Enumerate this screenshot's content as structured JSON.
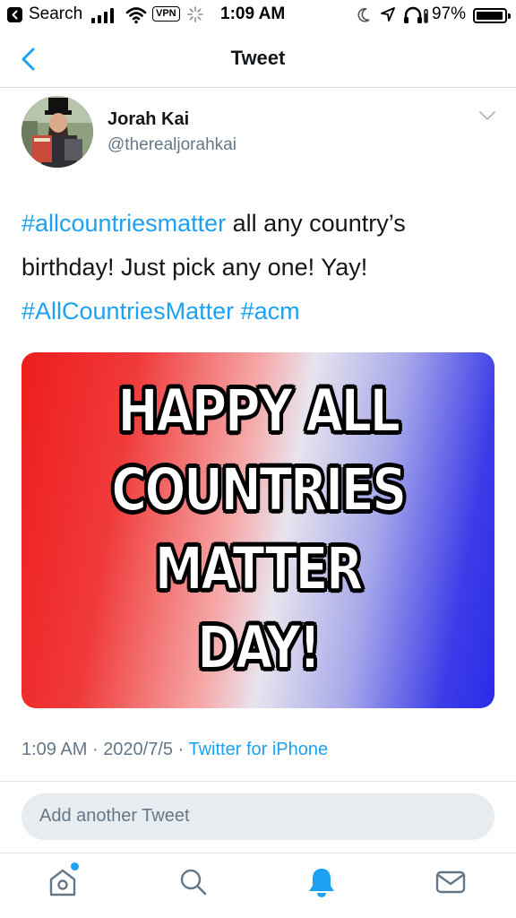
{
  "status_bar": {
    "back_app": "Search",
    "vpn": "VPN",
    "time": "1:09 AM",
    "battery_percent": "97%",
    "battery_level": 0.97
  },
  "header": {
    "title": "Tweet"
  },
  "tweet": {
    "author_name": "Jorah Kai",
    "author_handle": "@therealjorahkai",
    "text_segments": [
      {
        "text": "#allcountriesmatter",
        "hashtag": true
      },
      {
        "text": " all any country’s birthday! Just pick any one! Yay! ",
        "hashtag": false
      },
      {
        "text": "#AllCountriesMatter",
        "hashtag": true
      },
      {
        "text": " ",
        "hashtag": false
      },
      {
        "text": "#acm",
        "hashtag": true
      }
    ],
    "image_text_lines": [
      "HAPPY ALL",
      "COUNTRIES",
      "MATTER",
      "DAY!"
    ],
    "time": "1:09 AM",
    "separator": "·",
    "date": "2020/7/5",
    "source": "Twitter for iPhone"
  },
  "reply": {
    "placeholder": "Add another Tweet"
  },
  "tab_bar": {
    "icons": [
      "home-icon",
      "search-icon",
      "notifications-icon",
      "messages-icon"
    ],
    "active": "notifications",
    "home_has_new": true
  },
  "colors": {
    "accent": "#1da1f2",
    "secondary_text": "#657786",
    "primary_text": "#14171a",
    "input_bg": "#e6ecf0"
  }
}
